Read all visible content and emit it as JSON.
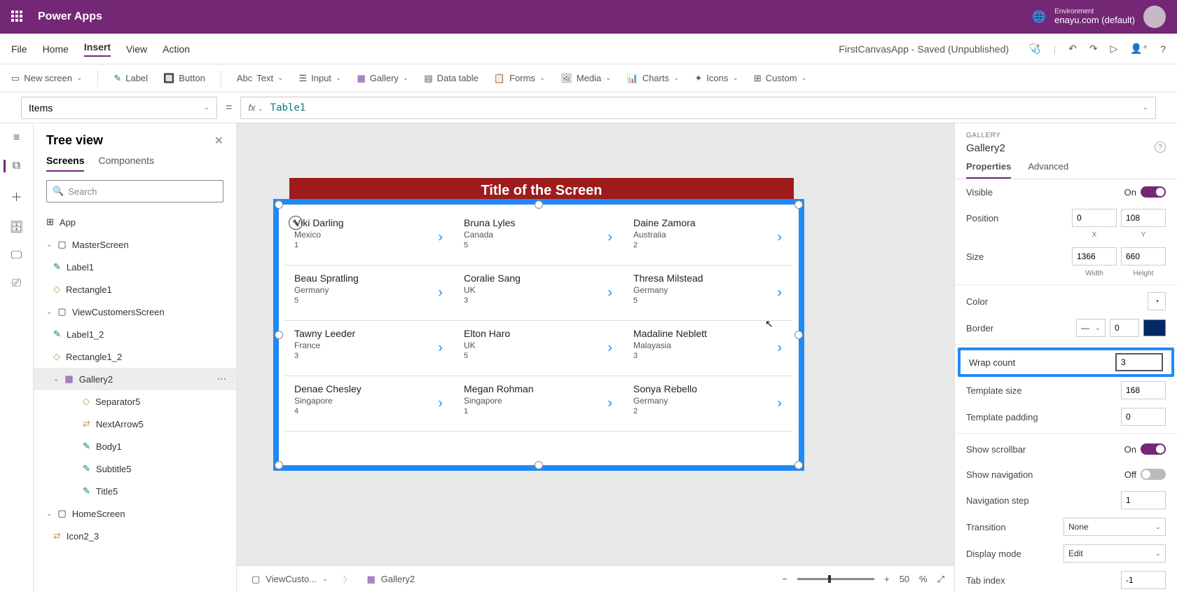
{
  "header": {
    "app_title": "Power Apps",
    "env_label": "Environment",
    "env_name": "enayu.com (default)"
  },
  "menubar": {
    "items": [
      "File",
      "Home",
      "Insert",
      "View",
      "Action"
    ],
    "active": "Insert",
    "doc_name": "FirstCanvasApp - Saved (Unpublished)"
  },
  "toolbar": {
    "new_screen": "New screen",
    "label": "Label",
    "button": "Button",
    "text": "Text",
    "input": "Input",
    "gallery": "Gallery",
    "data_table": "Data table",
    "forms": "Forms",
    "media": "Media",
    "charts": "Charts",
    "icons": "Icons",
    "custom": "Custom"
  },
  "formula": {
    "property": "Items",
    "fx": "fx",
    "value": "Table1"
  },
  "tree": {
    "title": "Tree view",
    "tabs": {
      "screens": "Screens",
      "components": "Components"
    },
    "search_placeholder": "Search",
    "items": {
      "app": "App",
      "master": "MasterScreen",
      "label1": "Label1",
      "rectangle1": "Rectangle1",
      "view": "ViewCustomersScreen",
      "label1_2": "Label1_2",
      "rectangle1_2": "Rectangle1_2",
      "gallery2": "Gallery2",
      "separator5": "Separator5",
      "nextarrow5": "NextArrow5",
      "body1": "Body1",
      "subtitle5": "Subtitle5",
      "title5": "Title5",
      "home": "HomeScreen",
      "icon2_3": "Icon2_3"
    }
  },
  "canvas": {
    "screen_title": "Title of the Screen",
    "rows": [
      [
        {
          "name": "Viki Darling",
          "country": "Mexico",
          "num": "1"
        },
        {
          "name": "Bruna Lyles",
          "country": "Canada",
          "num": "5"
        },
        {
          "name": "Daine Zamora",
          "country": "Australia",
          "num": "2"
        }
      ],
      [
        {
          "name": "Beau Spratling",
          "country": "Germany",
          "num": "5"
        },
        {
          "name": "Coralie Sang",
          "country": "UK",
          "num": "3"
        },
        {
          "name": "Thresa Milstead",
          "country": "Germany",
          "num": "5"
        }
      ],
      [
        {
          "name": "Tawny Leeder",
          "country": "France",
          "num": "3"
        },
        {
          "name": "Elton Haro",
          "country": "UK",
          "num": "5"
        },
        {
          "name": "Madaline Neblett",
          "country": "Malayasia",
          "num": "3"
        }
      ],
      [
        {
          "name": "Denae Chesley",
          "country": "Singapore",
          "num": "4"
        },
        {
          "name": "Megan Rohman",
          "country": "Singapore",
          "num": "1"
        },
        {
          "name": "Sonya Rebello",
          "country": "Germany",
          "num": "2"
        }
      ]
    ]
  },
  "props": {
    "category": "GALLERY",
    "name": "Gallery2",
    "tabs": {
      "properties": "Properties",
      "advanced": "Advanced"
    },
    "visible": {
      "label": "Visible",
      "value": "On"
    },
    "position": {
      "label": "Position",
      "x": "0",
      "y": "108",
      "xl": "X",
      "yl": "Y"
    },
    "size": {
      "label": "Size",
      "w": "1366",
      "h": "660",
      "wl": "Width",
      "hl": "Height"
    },
    "color": {
      "label": "Color"
    },
    "border": {
      "label": "Border",
      "val": "0"
    },
    "wrap": {
      "label": "Wrap count",
      "val": "3"
    },
    "tsize": {
      "label": "Template size",
      "val": "168"
    },
    "tpad": {
      "label": "Template padding",
      "val": "0"
    },
    "scrollbar": {
      "label": "Show scrollbar",
      "val": "On"
    },
    "nav": {
      "label": "Show navigation",
      "val": "Off"
    },
    "navstep": {
      "label": "Navigation step",
      "val": "1"
    },
    "transition": {
      "label": "Transition",
      "val": "None"
    },
    "dmode": {
      "label": "Display mode",
      "val": "Edit"
    },
    "tab": {
      "label": "Tab index",
      "val": "-1"
    }
  },
  "status": {
    "screen": "ViewCusto...",
    "gallery": "Gallery2",
    "zoom": "50",
    "pct": "%"
  }
}
